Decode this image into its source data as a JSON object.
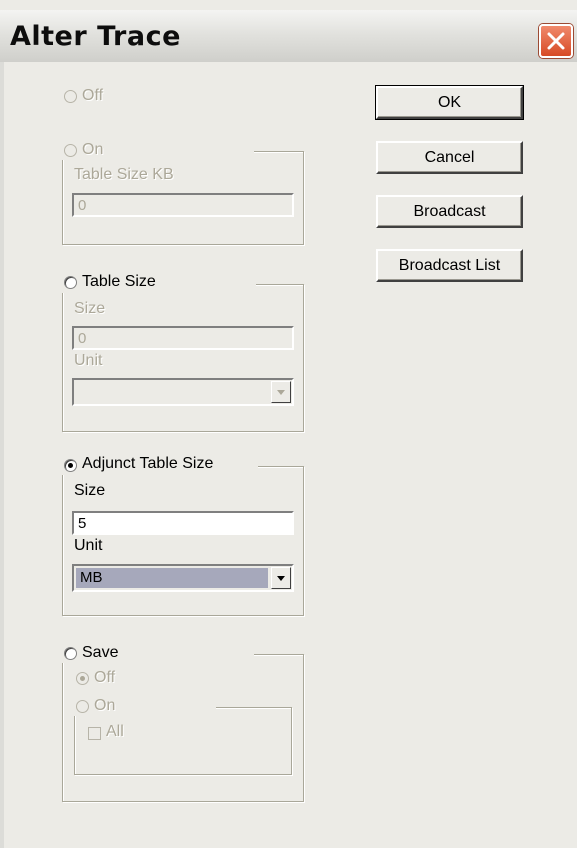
{
  "window": {
    "title": "Alter Trace"
  },
  "trace": {
    "off_label": "Off",
    "on_label": "On",
    "table_size_kb_label": "Table Size KB",
    "table_size_kb_value": "0"
  },
  "table_size": {
    "label": "Table Size",
    "size_label": "Size",
    "size_value": "0",
    "unit_label": "Unit",
    "unit_value": ""
  },
  "adjunct": {
    "label": "Adjunct Table Size",
    "size_label": "Size",
    "size_value": "5",
    "unit_label": "Unit",
    "unit_value": "MB"
  },
  "save": {
    "label": "Save",
    "off_label": "Off",
    "on_label": "On",
    "all_label": "All"
  },
  "buttons": {
    "ok": "OK",
    "cancel": "Cancel",
    "broadcast": "Broadcast",
    "broadcast_list": "Broadcast List"
  }
}
